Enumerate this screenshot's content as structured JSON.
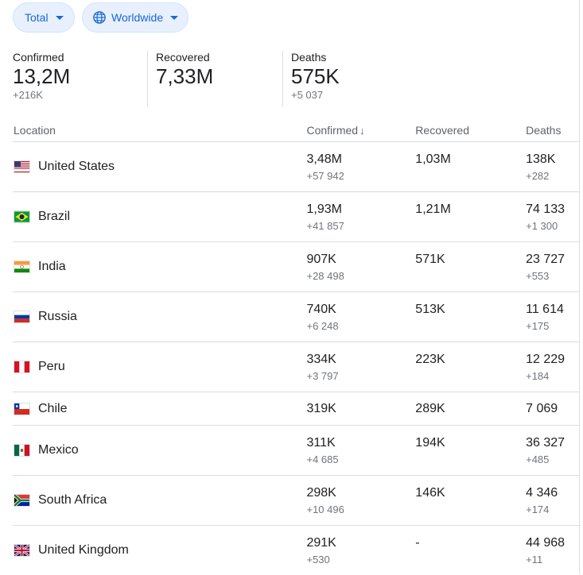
{
  "filters": {
    "metric": "Total",
    "region": "Worldwide"
  },
  "summary": [
    {
      "label": "Confirmed",
      "value": "13,2M",
      "delta": "+216K"
    },
    {
      "label": "Recovered",
      "value": "7,33M",
      "delta": ""
    },
    {
      "label": "Deaths",
      "value": "575K",
      "delta": "+5 037"
    }
  ],
  "table": {
    "headers": {
      "location": "Location",
      "confirmed": "Confirmed",
      "recovered": "Recovered",
      "deaths": "Deaths",
      "sort_indicator": "↓"
    },
    "rows": [
      {
        "flag": "us-flag-icon",
        "location": "United States",
        "confirmed": "3,48M",
        "confirmed_delta": "+57 942",
        "recovered": "1,03M",
        "deaths": "138K",
        "deaths_delta": "+282"
      },
      {
        "flag": "brazil-flag-icon",
        "location": "Brazil",
        "confirmed": "1,93M",
        "confirmed_delta": "+41 857",
        "recovered": "1,21M",
        "deaths": "74 133",
        "deaths_delta": "+1 300"
      },
      {
        "flag": "india-flag-icon",
        "location": "India",
        "confirmed": "907K",
        "confirmed_delta": "+28 498",
        "recovered": "571K",
        "deaths": "23 727",
        "deaths_delta": "+553"
      },
      {
        "flag": "russia-flag-icon",
        "location": "Russia",
        "confirmed": "740K",
        "confirmed_delta": "+6 248",
        "recovered": "513K",
        "deaths": "11 614",
        "deaths_delta": "+175"
      },
      {
        "flag": "peru-flag-icon",
        "location": "Peru",
        "confirmed": "334K",
        "confirmed_delta": "+3 797",
        "recovered": "223K",
        "deaths": "12 229",
        "deaths_delta": "+184"
      },
      {
        "flag": "chile-flag-icon",
        "location": "Chile",
        "confirmed": "319K",
        "confirmed_delta": "",
        "recovered": "289K",
        "deaths": "7 069",
        "deaths_delta": ""
      },
      {
        "flag": "mexico-flag-icon",
        "location": "Mexico",
        "confirmed": "311K",
        "confirmed_delta": "+4 685",
        "recovered": "194K",
        "deaths": "36 327",
        "deaths_delta": "+485"
      },
      {
        "flag": "south-africa-flag-icon",
        "location": "South Africa",
        "confirmed": "298K",
        "confirmed_delta": "+10 496",
        "recovered": "146K",
        "deaths": "4 346",
        "deaths_delta": "+174"
      },
      {
        "flag": "uk-flag-icon",
        "location": "United Kingdom",
        "confirmed": "291K",
        "confirmed_delta": "+530",
        "recovered": "-",
        "deaths": "44 968",
        "deaths_delta": "+11"
      }
    ]
  },
  "colors": {
    "chip_bg": "#e8f0fe",
    "chip_text": "#1967d2",
    "divider": "#dadce0",
    "muted": "#70757a"
  }
}
